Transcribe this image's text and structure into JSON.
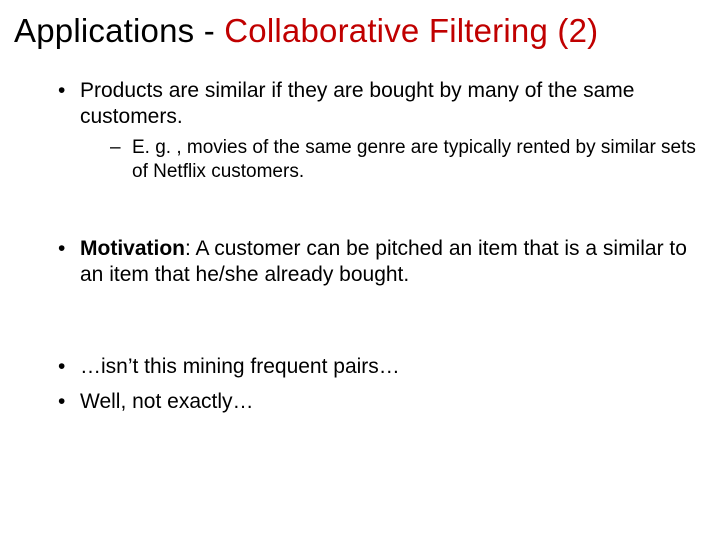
{
  "title": {
    "part_a": "Applications - ",
    "part_b": "Collaborative Filtering (2)"
  },
  "bullets": {
    "b1": "Products are similar if they are bought by many of the same customers.",
    "b1_sub1": "E. g. , movies of the same genre are typically rented by similar sets of Netflix customers.",
    "b2_label": "Motivation",
    "b2_rest": ": A customer can be pitched an item that is a similar to an item that he/she already bought.",
    "b3": "…isn’t this mining frequent pairs…",
    "b4": "Well, not exactly…"
  }
}
